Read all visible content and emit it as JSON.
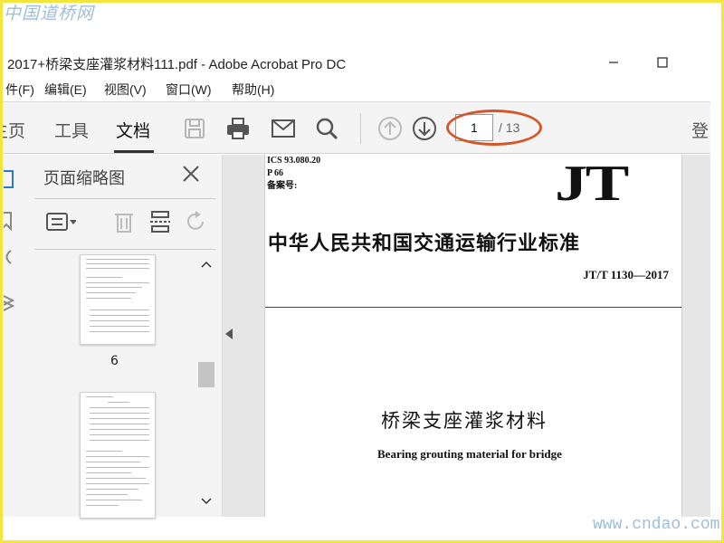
{
  "watermark_top": "中国道桥网",
  "watermark_bottom": "www.cndao.com",
  "window": {
    "title": "2017+桥梁支座灌浆材料111.pdf - Adobe Acrobat Pro DC",
    "minimize_label": "—",
    "maximize_label": "□"
  },
  "menu": {
    "items": [
      {
        "label": "件(F)"
      },
      {
        "label": "编辑(E)"
      },
      {
        "label": "视图(V)"
      },
      {
        "label": "窗口(W)"
      },
      {
        "label": "帮助(H)"
      }
    ]
  },
  "toolbar": {
    "tabs": [
      {
        "label": "主页"
      },
      {
        "label": "工具"
      },
      {
        "label": "文档"
      }
    ],
    "active_tab": "文档",
    "page_current": "1",
    "page_total": "/ 13",
    "login_label": "登"
  },
  "thumbnails_panel": {
    "title": "页面缩略图",
    "page_label": "6"
  },
  "document": {
    "ics": "ICS 93.080.20",
    "class_code": "P 66",
    "record_label": "备案号:",
    "logo": "JT",
    "standard_title": "中华人民共和国交通运输行业标准",
    "standard_number": "JT/T 1130—2017",
    "cn_title": "桥梁支座灌浆材料",
    "en_title": "Bearing grouting material for bridge"
  },
  "colors": {
    "frame": "#f2e63c",
    "annotation_ellipse": "#d2582a",
    "watermark": "#9dbfd8"
  }
}
